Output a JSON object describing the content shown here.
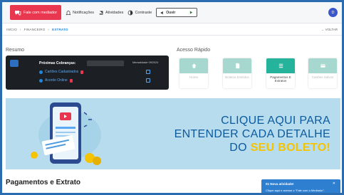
{
  "topbar": {
    "talk_label": "Fale com mediador",
    "nav": [
      "Notificações",
      "Atividades",
      "Contraste"
    ],
    "hear_label": "Ouvir",
    "avatar_initial": "D"
  },
  "breadcrumb": [
    "INÍCIO",
    "FINANCEIRO",
    "EXTRATO"
  ],
  "back_label": "VOLTAR",
  "resumo": {
    "title": "Resumo",
    "card_title": "Próximas Cobranças:",
    "month_label": "Mensalidade 09/2024",
    "rows": [
      "Cartões Cadastrados",
      "Acordo Online"
    ]
  },
  "acesso_rapido": {
    "title": "Acesso Rápido",
    "items": [
      {
        "label": "Home",
        "icon": "home-icon",
        "color": "#a7d8cf",
        "active": false
      },
      {
        "label": "Boletos Emitidos",
        "icon": "document-icon",
        "color": "#a7d8cf",
        "active": false
      },
      {
        "label": "Pagamentos E Extratos",
        "icon": "list-icon",
        "color": "#26b39b",
        "active": true
      },
      {
        "label": "Cartões Salvos",
        "icon": "card-icon",
        "color": "#a7d8cf",
        "active": false
      }
    ]
  },
  "banner": {
    "line1": "CLIQUE AQUI PARA",
    "line2": "ENTENDER CADA DETALHE",
    "line3_pre": "DO",
    "line3_hl": "SEU BOLETO!"
  },
  "pagamentos_title": "Pagamentos e Extrato",
  "toast": {
    "title": "01 Nova atividade!",
    "message": "Clique aqui e acesse o \"Fale com o Mediador\"."
  },
  "colors": {
    "brand_red": "#e8374e",
    "accent_blue": "#1e88e5",
    "teal": "#26b39b",
    "banner_bg": "#b7dcee",
    "banner_yellow": "#f5c400"
  }
}
